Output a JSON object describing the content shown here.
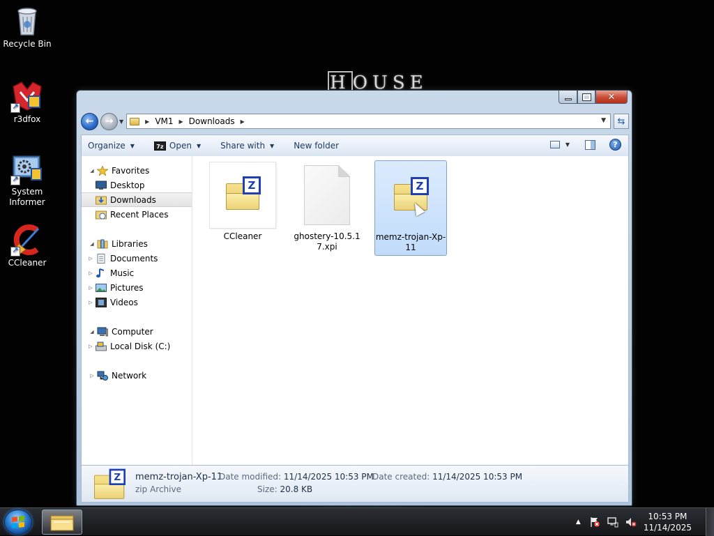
{
  "desktop": {
    "wallpaper_title": "HOUSE",
    "icons": [
      {
        "label": "Recycle Bin",
        "icon": "recycle-bin-icon"
      },
      {
        "label": "r3dfox",
        "icon": "r3dfox-icon"
      },
      {
        "label": "System Informer",
        "icon": "system-informer-icon"
      },
      {
        "label": "CCleaner",
        "icon": "ccleaner-icon"
      }
    ]
  },
  "window": {
    "caption": {
      "minimize": "minimize-icon",
      "maximize": "maximize-icon",
      "close": "close-icon"
    },
    "address": {
      "crumbs": [
        "VM1",
        "Downloads"
      ]
    },
    "toolbar": {
      "organize": "Organize",
      "open": "Open",
      "share_with": "Share with",
      "new_folder": "New folder",
      "open_icon_text": "7z"
    },
    "nav": {
      "favorites": "Favorites",
      "desktop": "Desktop",
      "downloads": "Downloads",
      "recent_places": "Recent Places",
      "libraries": "Libraries",
      "documents": "Documents",
      "music": "Music",
      "pictures": "Pictures",
      "videos": "Videos",
      "computer": "Computer",
      "local_disk": "Local Disk (C:)",
      "network": "Network"
    },
    "files": [
      {
        "name": "CCleaner",
        "type": "zip-folder-icon"
      },
      {
        "name": "ghostery-10.5.17.xpi",
        "type": "blank-file-icon"
      },
      {
        "name": "memz-trojan-Xp-11",
        "type": "zip-folder-icon",
        "selected": true
      }
    ],
    "details": {
      "name": "memz-trojan-Xp-11",
      "type": "zip Archive",
      "date_modified_label": "Date modified:",
      "date_modified": "11/14/2025 10:53 PM",
      "date_created_label": "Date created:",
      "date_created": "11/14/2025 10:53 PM",
      "size_label": "Size:",
      "size": "20.8 KB"
    }
  },
  "taskbar": {
    "clock_time": "10:53 PM",
    "clock_date": "11/14/2025"
  },
  "colors": {
    "accent": "#1f3fb5",
    "selection": "#c1dcfb",
    "close_button": "#c94a33"
  }
}
